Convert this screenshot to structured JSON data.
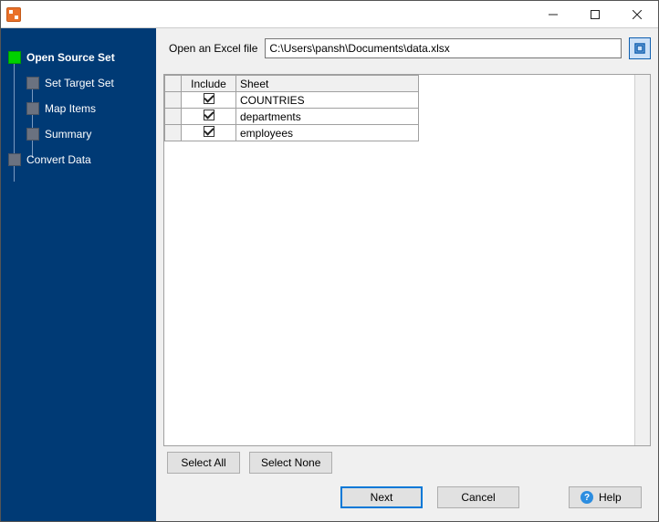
{
  "nav": {
    "items": [
      {
        "label": "Open Source Set",
        "active": true,
        "child": false
      },
      {
        "label": "Set Target Set",
        "active": false,
        "child": true
      },
      {
        "label": "Map Items",
        "active": false,
        "child": true
      },
      {
        "label": "Summary",
        "active": false,
        "child": true
      },
      {
        "label": "Convert Data",
        "active": false,
        "child": false
      }
    ]
  },
  "file": {
    "label": "Open an Excel file",
    "path": "C:\\Users\\pansh\\Documents\\data.xlsx"
  },
  "grid": {
    "headers": {
      "include": "Include",
      "sheet": "Sheet"
    },
    "rows": [
      {
        "include": true,
        "sheet": "COUNTRIES"
      },
      {
        "include": true,
        "sheet": "departments"
      },
      {
        "include": true,
        "sheet": "employees"
      }
    ]
  },
  "buttons": {
    "select_all": "Select All",
    "select_none": "Select None",
    "next": "Next",
    "cancel": "Cancel",
    "help": "Help"
  }
}
